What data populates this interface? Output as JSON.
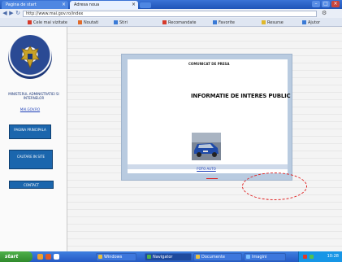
{
  "browser": {
    "tabs": [
      {
        "label": "Pagina de start"
      },
      {
        "label": "Adresa noua"
      }
    ],
    "address": "http://www.mai.gov.ro/index",
    "window_buttons": [
      "minimize-icon",
      "maximize-icon",
      "close-icon"
    ],
    "bookmarks": [
      {
        "label": "Cele mai vizitate",
        "icon_color": "#d63a2a"
      },
      {
        "label": "Noutati",
        "icon_color": "#e06b2a"
      },
      {
        "label": "Stiri",
        "icon_color": "#3a7ad6"
      },
      {
        "label": "Recomandate",
        "icon_color": "#d63a2a"
      },
      {
        "label": "Favorite",
        "icon_color": "#3a7ad6"
      },
      {
        "label": "Resurse",
        "icon_color": "#e0b82a"
      },
      {
        "label": "Ajutor",
        "icon_color": "#3a7ad6"
      }
    ]
  },
  "sidebar": {
    "institution": "MINISTERUL ADMINISTRATIEI SI INTERNELOR",
    "link": "MAI.GOV.RO",
    "buttons": [
      "PAGINA PRINCIPALA",
      "CAUTARE IN SITE",
      "CONTACT"
    ]
  },
  "document": {
    "title": "COMUNICAT DE PRESA",
    "heading": "INFORMATIE DE INTERES PUBLIC",
    "photo_caption": "FOTO AUTO"
  },
  "taskbar": {
    "start_label": "start",
    "tasks": [
      "Windows",
      "Navigator",
      "Documente",
      "Imagini"
    ],
    "clock": "10:28",
    "accent": "#2459c4"
  }
}
